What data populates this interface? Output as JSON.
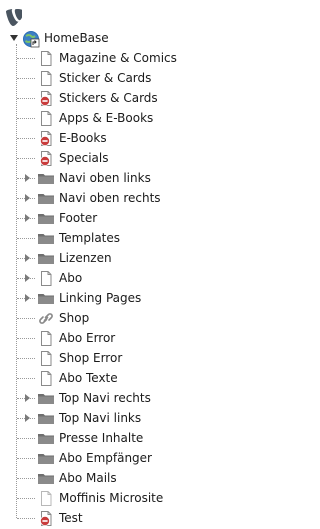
{
  "root": {
    "label": "HomeBase",
    "icon": "homebase-globe-icon"
  },
  "items": [
    {
      "label": "Magazine & Comics",
      "icon": "page-icon",
      "expandable": false
    },
    {
      "label": "Sticker & Cards",
      "icon": "page-icon",
      "expandable": false
    },
    {
      "label": "Stickers & Cards",
      "icon": "page-hidden-icon",
      "expandable": false
    },
    {
      "label": "Apps & E-Books",
      "icon": "page-icon",
      "expandable": false
    },
    {
      "label": "E-Books",
      "icon": "page-hidden-icon",
      "expandable": false
    },
    {
      "label": "Specials",
      "icon": "page-hidden-icon",
      "expandable": false
    },
    {
      "label": "Navi oben links",
      "icon": "folder-icon",
      "expandable": true
    },
    {
      "label": "Navi oben rechts",
      "icon": "folder-icon",
      "expandable": true
    },
    {
      "label": "Footer",
      "icon": "folder-icon",
      "expandable": true
    },
    {
      "label": "Templates",
      "icon": "folder-icon",
      "expandable": false
    },
    {
      "label": "Lizenzen",
      "icon": "folder-icon",
      "expandable": true
    },
    {
      "label": "Abo",
      "icon": "page-icon",
      "expandable": true
    },
    {
      "label": "Linking Pages",
      "icon": "folder-icon",
      "expandable": true
    },
    {
      "label": "Shop",
      "icon": "link-icon",
      "expandable": false
    },
    {
      "label": "Abo Error",
      "icon": "page-icon",
      "expandable": false
    },
    {
      "label": "Shop Error",
      "icon": "page-icon",
      "expandable": false
    },
    {
      "label": "Abo Texte",
      "icon": "page-icon",
      "expandable": false
    },
    {
      "label": "Top Navi rechts",
      "icon": "folder-icon",
      "expandable": true
    },
    {
      "label": "Top Navi links",
      "icon": "folder-icon",
      "expandable": true
    },
    {
      "label": "Presse Inhalte",
      "icon": "folder-icon",
      "expandable": false
    },
    {
      "label": "Abo Empfänger",
      "icon": "folder-icon",
      "expandable": false
    },
    {
      "label": "Abo Mails",
      "icon": "folder-icon",
      "expandable": false
    },
    {
      "label": "Moffinis Microsite",
      "icon": "page-light-icon",
      "expandable": false
    },
    {
      "label": "Test",
      "icon": "page-hidden-icon",
      "expandable": false
    }
  ],
  "colors": {
    "hidden_badge": "#c83c3c",
    "folder": "#6e6e6e",
    "globe": "#2a6db5",
    "logo": "#4a5560"
  }
}
